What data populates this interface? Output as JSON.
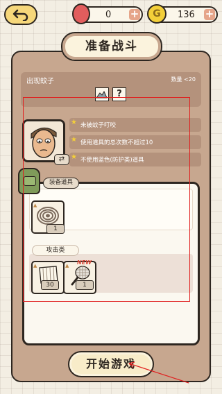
{
  "header": {
    "back_icon": "back-arrow-icon",
    "resources": {
      "bean_value": "0",
      "coin_value": "136",
      "coin_letter": "G",
      "plus": "+"
    }
  },
  "title": "准备战斗",
  "level": {
    "name": "出现蚊子",
    "count_label": "数量 <20",
    "help_icon_text": "?"
  },
  "conditions": [
    {
      "text": "未被蚊子叮咬"
    },
    {
      "text": "使用道具的总次数不超过10"
    },
    {
      "text": "不使用蓝色(防护类)道具"
    }
  ],
  "swap_icon_text": "⇄",
  "equipment": {
    "label": "装备道具",
    "items": [
      {
        "icon": "mosquito-coil-icon",
        "count": "1"
      }
    ]
  },
  "category": {
    "label": "攻击类",
    "items": [
      {
        "icon": "paper-fan-icon",
        "count": "30",
        "new": ""
      },
      {
        "icon": "electric-swatter-icon",
        "count": "1",
        "new": "NEW"
      }
    ]
  },
  "start_button": "开始游戏",
  "colors": {
    "background": "#f3eee3",
    "panel": "#c7a78f",
    "accent_red": "#e02020",
    "coin": "#f3cf39",
    "bean": "#e25d5d"
  }
}
